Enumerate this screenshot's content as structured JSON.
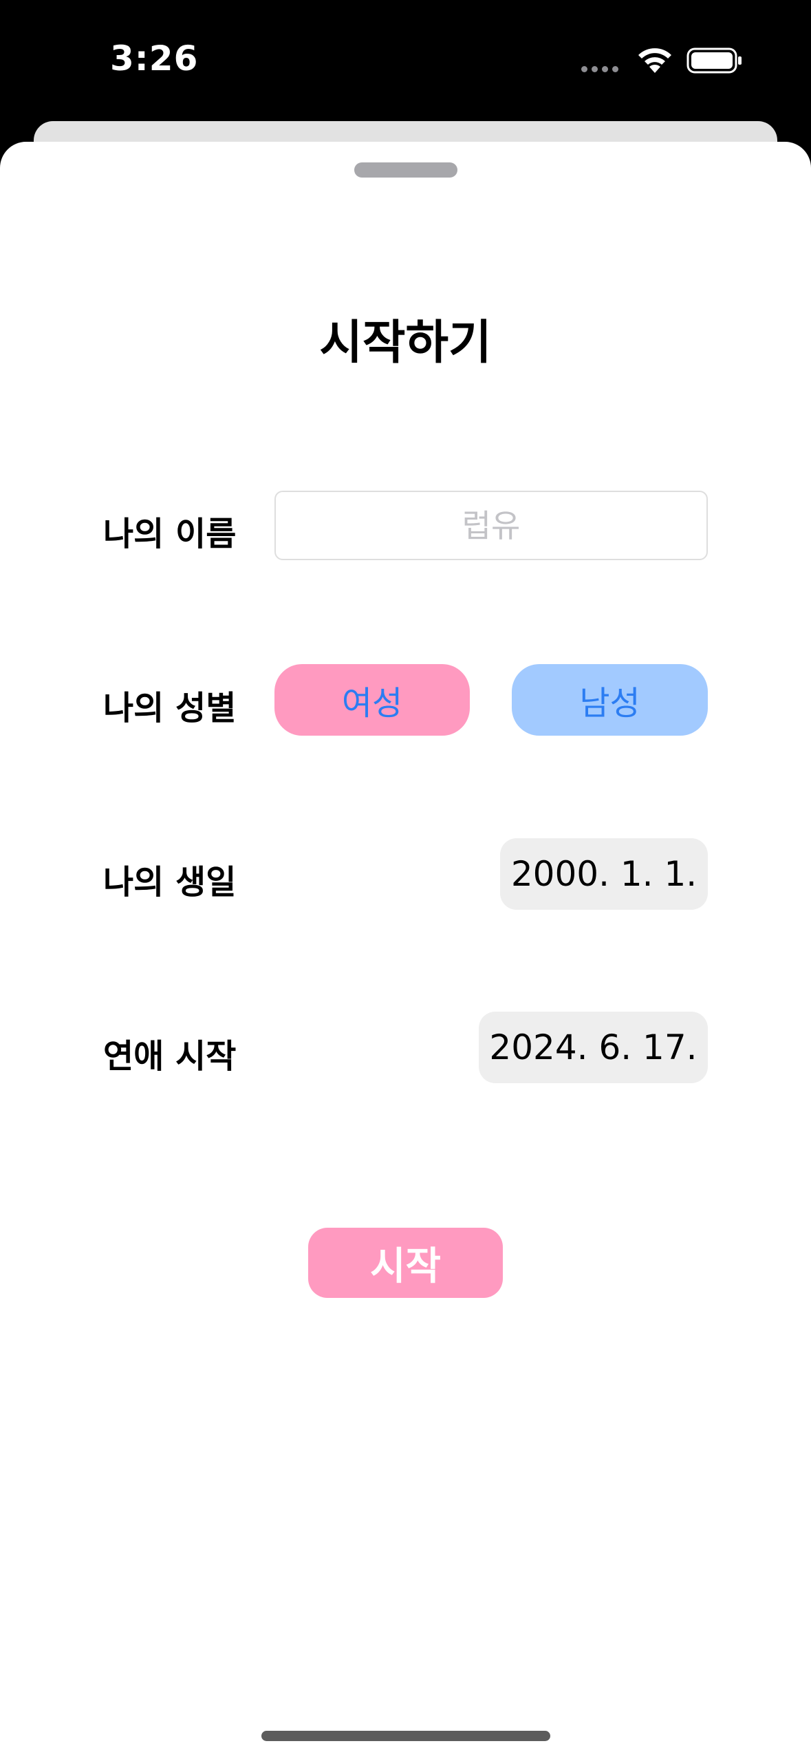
{
  "status_bar": {
    "time": "3:26",
    "icons": [
      "signal-dots-icon",
      "wifi-icon",
      "battery-icon"
    ]
  },
  "sheet": {
    "title": "시작하기",
    "name_row": {
      "label": "나의 이름",
      "input_value": "",
      "input_placeholder": "럽유"
    },
    "gender_row": {
      "label": "나의 성별",
      "female_label": "여성",
      "male_label": "남성"
    },
    "birthday_row": {
      "label": "나의 생일",
      "date": "2000. 1. 1."
    },
    "anniversary_row": {
      "label": "연애 시작",
      "date": "2024. 6. 17."
    },
    "start_button": "시작"
  },
  "colors": {
    "female": "#ff9ac0",
    "male": "#a2caff",
    "accent_text": "#2c7df2",
    "start_button": "#ff9ac0",
    "date_pill": "#eeeeee"
  }
}
